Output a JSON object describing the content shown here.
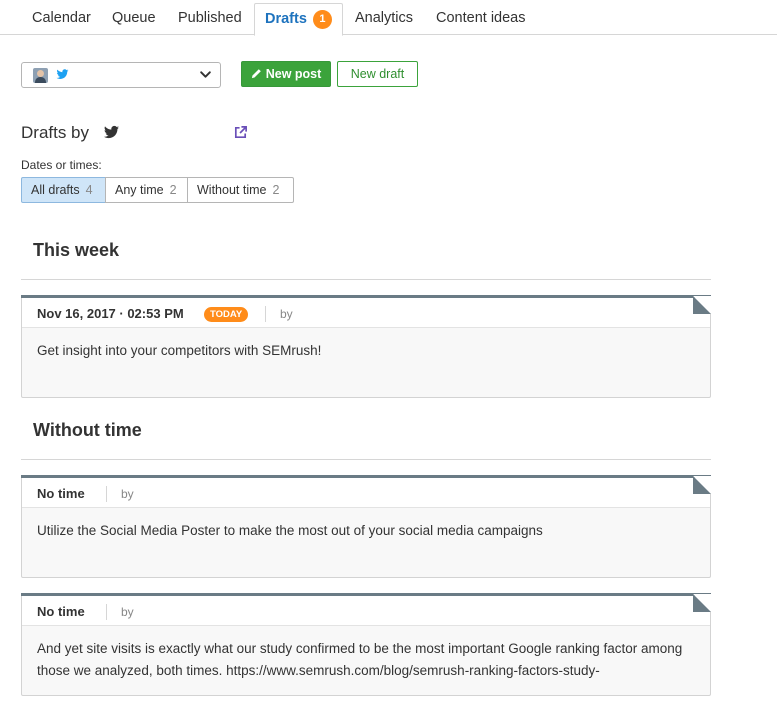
{
  "tabs": [
    {
      "label": "Calendar"
    },
    {
      "label": "Queue"
    },
    {
      "label": "Published"
    },
    {
      "label": "Drafts",
      "badge": "1"
    },
    {
      "label": "Analytics"
    },
    {
      "label": "Content ideas"
    }
  ],
  "toolbar": {
    "new_post_label": "New post",
    "new_draft_label": "New draft"
  },
  "drafts": {
    "title": "Drafts by",
    "dates_label": "Dates or times:",
    "filters": [
      {
        "label": "All drafts",
        "count": "4"
      },
      {
        "label": "Any time",
        "count": "2"
      },
      {
        "label": "Without time",
        "count": "2"
      }
    ]
  },
  "sections": [
    {
      "title": "This week",
      "cards": [
        {
          "when": "Nov 16, 2017 · 02:53 PM",
          "badge": "TODAY",
          "by": "by",
          "text": "Get insight into your competitors with SEMrush!"
        }
      ]
    },
    {
      "title": "Without time",
      "cards": [
        {
          "when": "No time",
          "by": "by",
          "text": "Utilize the Social Media Poster to make the most out of your social media campaigns"
        },
        {
          "when": "No time",
          "by": "by",
          "text": "And yet site visits is exactly what our study confirmed to be the most important Google ranking factor among those we analyzed, both times. https://www.semrush.com/blog/semrush-ranking-factors-study-"
        }
      ]
    }
  ],
  "colors": {
    "accent_blue": "#1e73be",
    "primary_green": "#3ba33b",
    "badge_orange": "#ff8c1a",
    "twitter_blue": "#1da1f2",
    "link_purple": "#6a4fb8"
  }
}
